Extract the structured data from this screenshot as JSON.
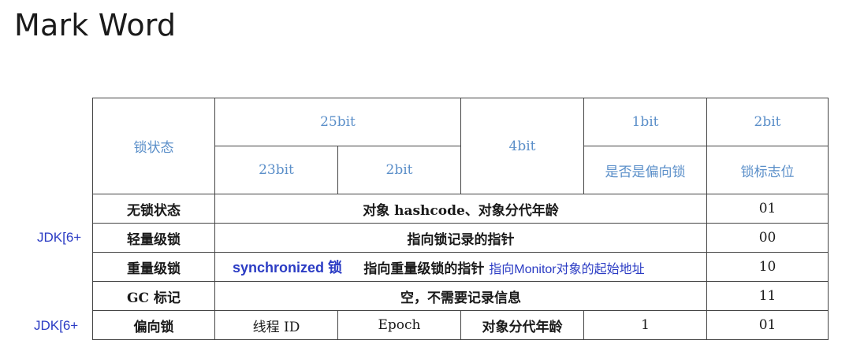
{
  "title": "Mark Word",
  "side_notes": [
    "JDK[6+",
    "JDK[6+"
  ],
  "table": {
    "header": {
      "lock_state": "锁状态",
      "bits25": "25bit",
      "bits4": "4bit",
      "bits1": "1bit",
      "bits2": "2bit",
      "bits23": "23bit",
      "bits2b": "2bit",
      "is_biased": "是否是偏向锁",
      "lock_flag": "锁标志位"
    },
    "rows": [
      {
        "state": "无锁状态",
        "content": "对象 hashcode、对象分代年龄",
        "flag": "01"
      },
      {
        "state": "轻量级锁",
        "content": "指向锁记录的指针",
        "flag": "00"
      },
      {
        "state": "重量级锁",
        "annotation": "synchronized 锁",
        "content": "指向重量级锁的指针",
        "annotation2": "指向Monitor对象的起始地址",
        "flag": "10"
      },
      {
        "state": "GC 标记",
        "content": "空，不需要记录信息",
        "flag": "11"
      },
      {
        "state": "偏向锁",
        "thread_id": "线程 ID",
        "epoch": "Epoch",
        "age": "对象分代年龄",
        "biased": "1",
        "flag": "01"
      }
    ]
  },
  "colors": {
    "header_text": "#5b8fc9",
    "annotation": "#2b3cc4",
    "border": "#444444"
  }
}
